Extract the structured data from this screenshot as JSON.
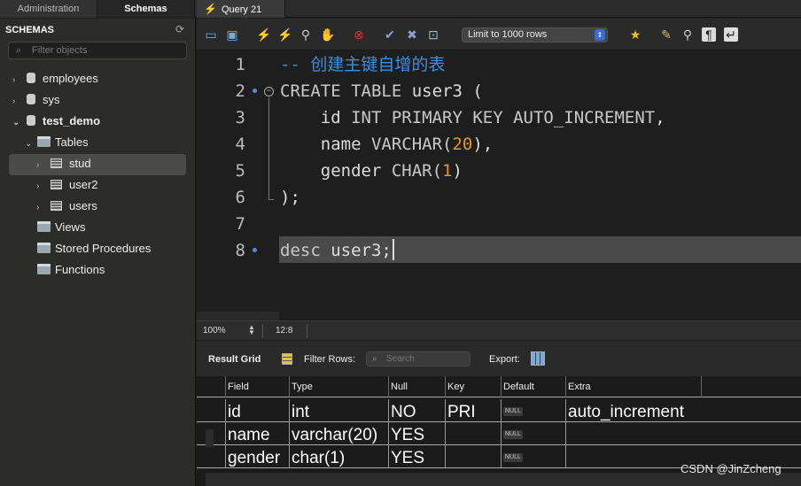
{
  "tabs": {
    "administration": "Administration",
    "schemas": "Schemas",
    "query": "Query 21"
  },
  "sidebar": {
    "title": "SCHEMAS",
    "filter_placeholder": "Filter objects",
    "schemas": [
      {
        "name": "employees",
        "expanded": false
      },
      {
        "name": "sys",
        "expanded": false
      },
      {
        "name": "test_demo",
        "expanded": true
      }
    ],
    "tables_label": "Tables",
    "tables": [
      "stud",
      "user2",
      "users"
    ],
    "views_label": "Views",
    "procedures_label": "Stored Procedures",
    "functions_label": "Functions"
  },
  "toolbar": {
    "limit_label": "Limit to 1000 rows"
  },
  "editor": {
    "line_numbers": [
      "1",
      "2",
      "3",
      "4",
      "5",
      "6",
      "7",
      "8"
    ],
    "lines": {
      "l1": "-- 创建主键自增的表",
      "l2_kw": "CREATE TABLE",
      "l2_rest": " user3 (",
      "l3_a": "    id ",
      "l3_kw": "INT PRIMARY KEY AUTO_INCREMENT",
      "l3_b": ",",
      "l4_a": "    name ",
      "l4_kw": "VARCHAR(",
      "l4_num": "20",
      "l4_b": "),",
      "l5_a": "    gender ",
      "l5_kw": "CHAR(",
      "l5_num": "1",
      "l5_b": ")",
      "l6": ");",
      "l8_kw": "desc",
      "l8_rest": " user3;"
    }
  },
  "status": {
    "zoom": "100%",
    "cursor_position": "12:8"
  },
  "result": {
    "grid_label": "Result Grid",
    "filter_label": "Filter Rows:",
    "search_placeholder": "Search",
    "export_label": "Export:",
    "columns": [
      "Field",
      "Type",
      "Null",
      "Key",
      "Default",
      "Extra"
    ],
    "rows": [
      {
        "field": "id",
        "type": "int",
        "null": "NO",
        "key": "PRI",
        "default": "NULL",
        "extra": "auto_increment"
      },
      {
        "field": "name",
        "type": "varchar(20)",
        "null": "YES",
        "key": "",
        "default": "NULL",
        "extra": ""
      },
      {
        "field": "gender",
        "type": "char(1)",
        "null": "YES",
        "key": "",
        "default": "NULL",
        "extra": ""
      }
    ]
  },
  "watermark": "CSDN @JinZcheng"
}
